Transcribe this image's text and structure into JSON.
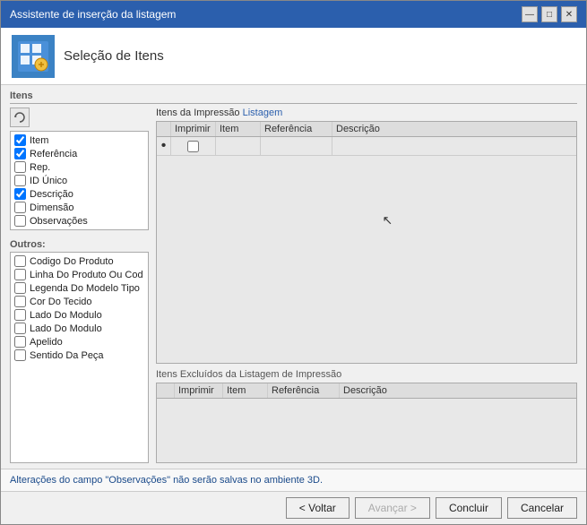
{
  "window": {
    "title": "Assistente de inserção da listagem",
    "controls": {
      "minimize": "—",
      "maximize": "□",
      "close": "✕"
    }
  },
  "header": {
    "title": "Seleção de Itens"
  },
  "items_section": {
    "label": "Itens"
  },
  "left_panel": {
    "checkboxes": [
      {
        "id": "chk_item",
        "label": "Item",
        "checked": true
      },
      {
        "id": "chk_ref",
        "label": "Referência",
        "checked": true
      },
      {
        "id": "chk_rep",
        "label": "Rep.",
        "checked": false
      },
      {
        "id": "chk_id",
        "label": "ID Único",
        "checked": false
      },
      {
        "id": "chk_desc",
        "label": "Descrição",
        "checked": true
      },
      {
        "id": "chk_dim",
        "label": "Dimensão",
        "checked": false
      },
      {
        "id": "chk_obs",
        "label": "Observações",
        "checked": false
      }
    ],
    "others_label": "Outros:",
    "others": [
      {
        "id": "chk_cod",
        "label": "Codigo Do Produto",
        "checked": false
      },
      {
        "id": "chk_lin",
        "label": "Linha Do Produto Ou Cod",
        "checked": false
      },
      {
        "id": "chk_leg",
        "label": "Legenda Do Modelo Tipo",
        "checked": false
      },
      {
        "id": "chk_cor",
        "label": "Cor Do Tecido",
        "checked": false
      },
      {
        "id": "chk_lm1",
        "label": "Lado Do Modulo",
        "checked": false
      },
      {
        "id": "chk_lm2",
        "label": "Lado Do Modulo",
        "checked": false
      },
      {
        "id": "chk_ape",
        "label": "Apelido",
        "checked": false
      },
      {
        "id": "chk_sen",
        "label": "Sentido Da Peça",
        "checked": false
      }
    ]
  },
  "right_panel": {
    "print_table": {
      "label": "Itens da Impressão",
      "link_label": "Listagem",
      "headers": [
        "",
        "Imprimir",
        "Item",
        "Referência",
        "Descrição"
      ],
      "rows": [
        {
          "dot": "•",
          "print": false,
          "item": "",
          "referencia": "",
          "descricao": ""
        }
      ]
    },
    "excluded_table": {
      "label": "Itens Excluídos da Listagem de Impressão",
      "headers": [
        "",
        "Imprimir",
        "Item",
        "Referência",
        "Descrição"
      ]
    }
  },
  "footer": {
    "note": "Alterações do campo \"Observações\" não serão salvas no ambiente 3D.",
    "buttons": {
      "back": "< Voltar",
      "next": "Avançar >",
      "finish": "Concluir",
      "cancel": "Cancelar"
    }
  }
}
